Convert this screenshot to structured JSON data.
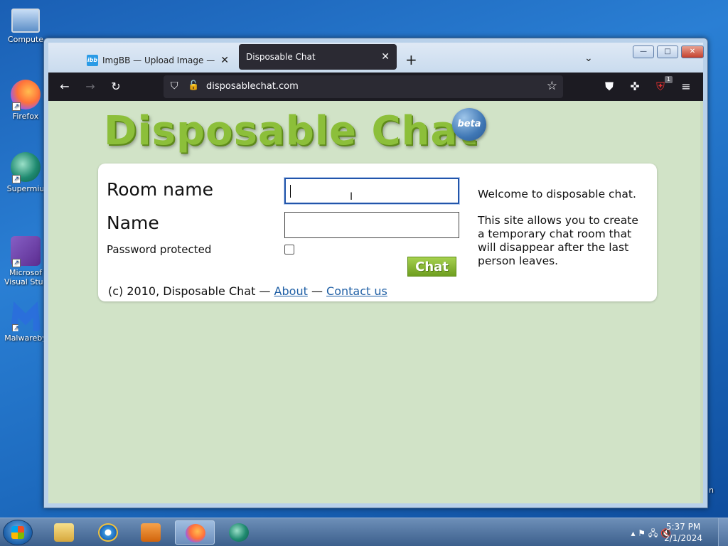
{
  "desktop": {
    "icons": [
      {
        "label": "Compute",
        "icon": "computer-icon"
      },
      {
        "label": "Firefox",
        "icon": "firefox-icon"
      },
      {
        "label": "Supermiu",
        "icon": "supermium-icon"
      },
      {
        "label": "Microsof\nVisual Stud",
        "line1": "Microsof",
        "line2": "Visual Stud",
        "icon": "visual-studio-icon"
      },
      {
        "label": "Malwareby",
        "icon": "malwarebytes-icon"
      }
    ],
    "edge_text": "n"
  },
  "browser": {
    "tabs": [
      {
        "title": "ImgBB — Upload Image — Free",
        "favicon": "ibb",
        "active": false
      },
      {
        "title": "Disposable Chat",
        "active": true
      }
    ],
    "new_tab": "+",
    "tab_list": "⌄",
    "window_controls": {
      "minimize": "—",
      "maximize": "□",
      "close": "✕"
    },
    "url": "disposablechat.com",
    "extension_badge": "1"
  },
  "page": {
    "logo": "Disposable Chat",
    "badge": "beta",
    "form": {
      "room_label": "Room name",
      "room_value": "",
      "name_label": "Name",
      "name_value": "",
      "password_label": "Password protected",
      "password_checked": false,
      "submit_label": "Chat"
    },
    "footer": {
      "copyright": "(c) 2010, Disposable Chat — ",
      "about": "About",
      "separator": " — ",
      "contact": "Contact us"
    },
    "side": {
      "welcome": "Welcome to disposable chat.",
      "description": "This site allows you to create a temporary chat room that will disappear after the last person leaves."
    }
  },
  "taskbar": {
    "time": "5:37 PM",
    "date": "2/1/2024",
    "apps": [
      "file-explorer",
      "internet-explorer",
      "media-player",
      "firefox",
      "supermium"
    ],
    "active_app": "firefox"
  },
  "colors": {
    "page_bg": "#d1e3c7",
    "logo_green": "#8cbf3a",
    "link": "#1f5fa5",
    "toolbar": "#1c1b22"
  }
}
